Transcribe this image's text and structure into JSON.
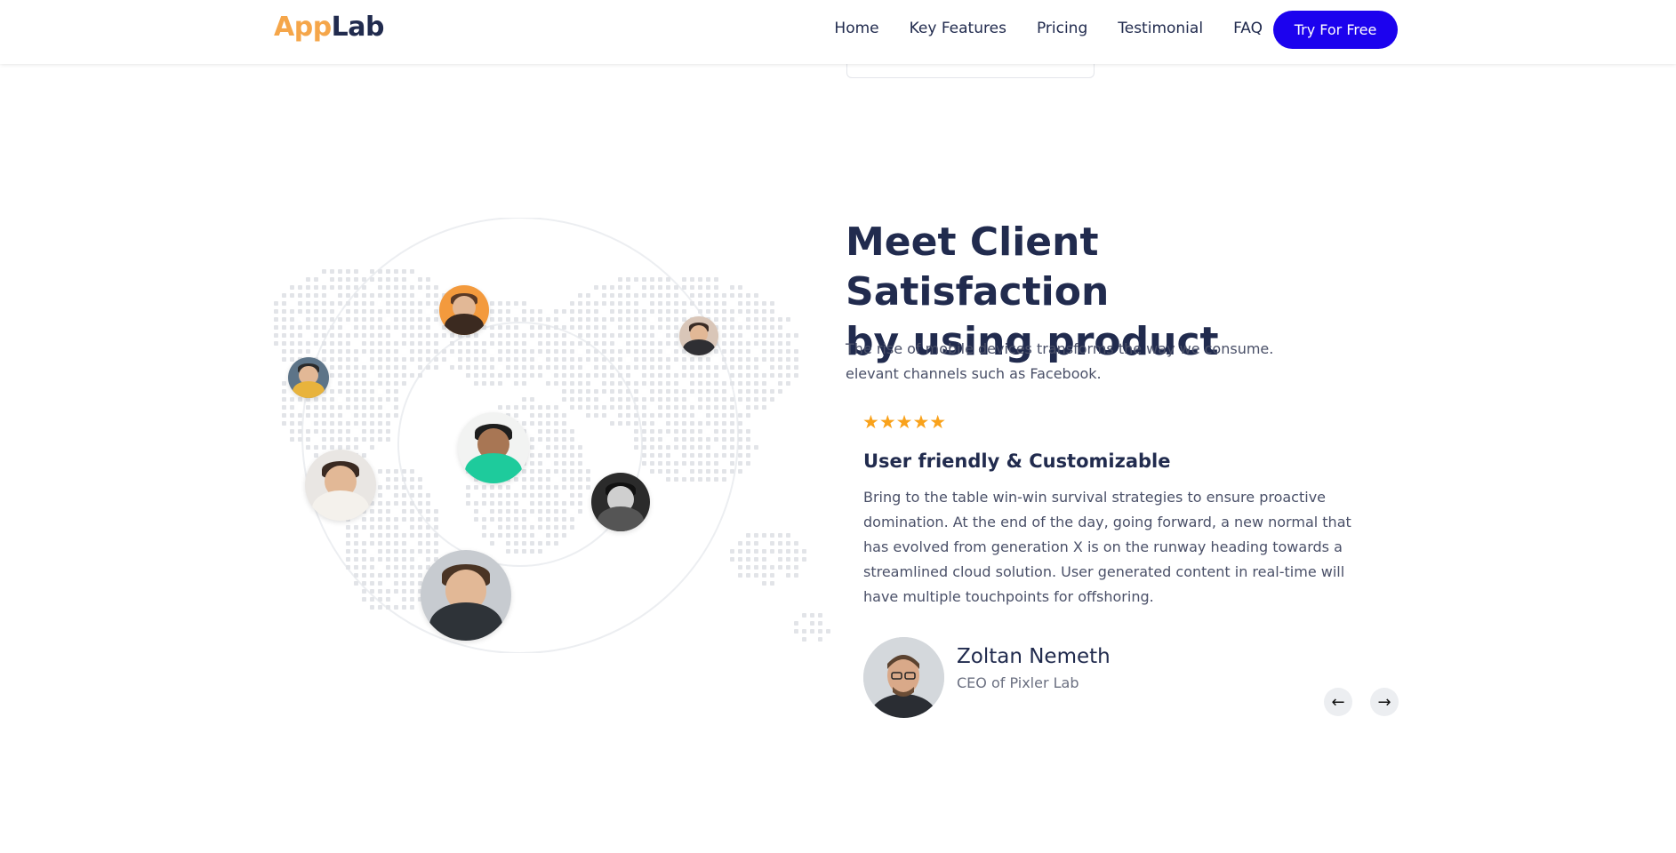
{
  "header": {
    "logo_part1": "App",
    "logo_part2": "Lab",
    "nav": [
      {
        "label": "Home"
      },
      {
        "label": "Key Features"
      },
      {
        "label": "Pricing"
      },
      {
        "label": "Testimonial"
      },
      {
        "label": "FAQ"
      }
    ],
    "cta_label": "Try For Free"
  },
  "section": {
    "title_line1": "Meet Client Satisfaction",
    "title_line2": "by using product",
    "desc_line1": "The rise of mobile devices transforms the way we consume.",
    "desc_line2": "elevant channels such as Facebook."
  },
  "testimonial": {
    "rating": 5,
    "stars": "★★★★★",
    "title": "User friendly & Customizable",
    "text": "Bring to the table win-win survival strategies to ensure proactive domination. At the end of the day, going forward, a new normal that has evolved from generation X is on the runway heading towards a streamlined cloud solution. User generated content in real-time will have multiple touchpoints for offshoring.",
    "author_name": "Zoltan Nemeth",
    "author_role": "CEO of Pixler Lab",
    "prev_icon": "arrow-left-icon",
    "next_icon": "arrow-right-icon",
    "prev_glyph": "←",
    "next_glyph": "→"
  },
  "colors": {
    "brand": "#1c02ee",
    "logo_accent": "#f5a64a",
    "heading": "#212b4e",
    "star": "#f9a21b"
  }
}
